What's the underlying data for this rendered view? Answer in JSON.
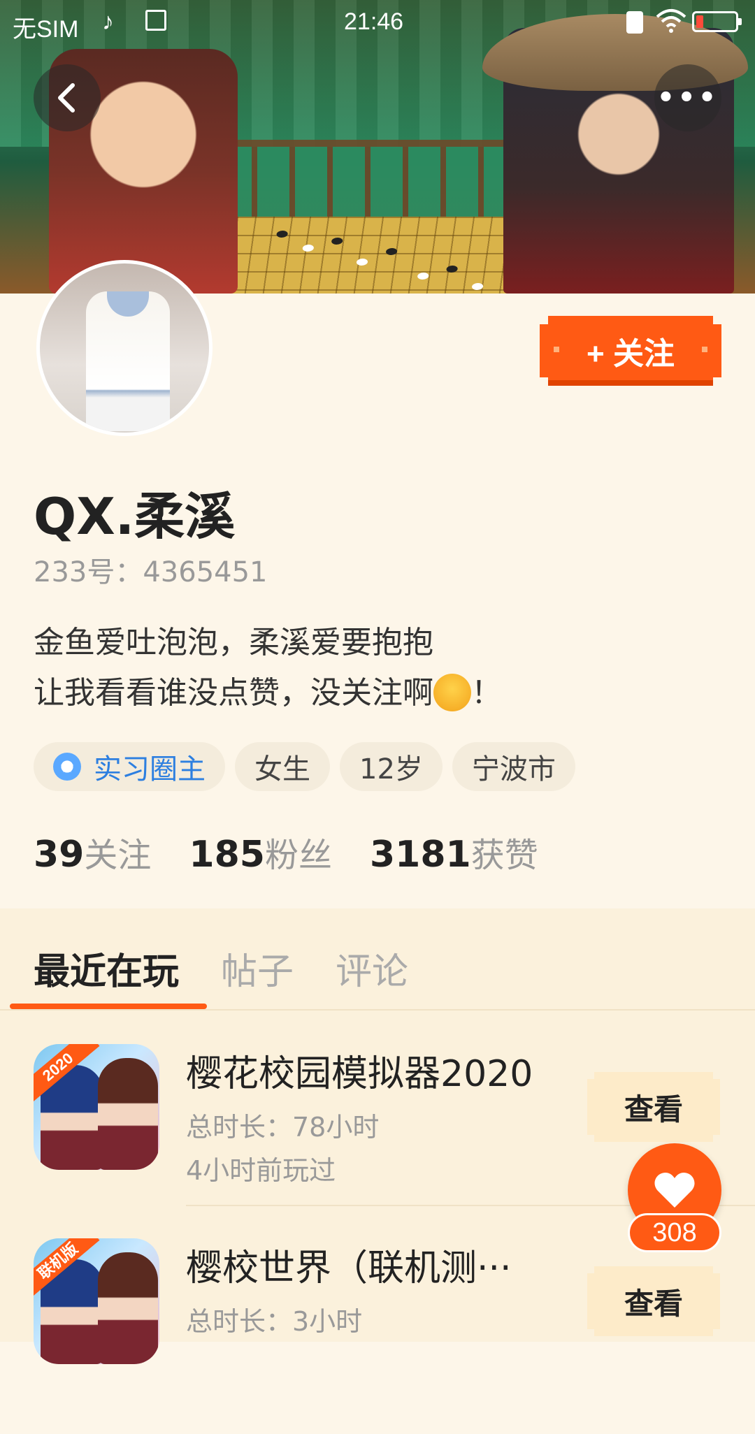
{
  "status_bar": {
    "carrier": "无SIM",
    "time": "21:46",
    "icons": [
      "tiktok-icon",
      "sim-icon",
      "charging-icon",
      "wifi-icon",
      "battery-low-icon"
    ]
  },
  "header": {
    "back_icon": "chevron-left-icon",
    "more_icon": "ellipsis-icon",
    "more_label": "•••"
  },
  "profile": {
    "follow_label": "+ 关注",
    "nickname": "QX.柔溪",
    "uid": "233号：4365451",
    "bio_line1": "金鱼爱吐泡泡，柔溪爱要抱抱",
    "bio_line2_before": "让我看看谁没点赞，没关注啊",
    "bio_line2_after": "！",
    "tags": {
      "badge": "实习圈主",
      "gender": "女生",
      "age": "12岁",
      "city": "宁波市"
    },
    "stats": {
      "following_num": "39",
      "following_label": "关注",
      "fans_num": "185",
      "fans_label": "粉丝",
      "likes_num": "3181",
      "likes_label": "获赞"
    }
  },
  "tabs": {
    "recent": "最近在玩",
    "posts": "帖子",
    "comments": "评论",
    "active": "最近在玩"
  },
  "games": [
    {
      "title": "樱花校园模拟器2020",
      "ribbon": "2020",
      "duration": "总时长：78小时",
      "last_played": "4小时前玩过",
      "button": "查看"
    },
    {
      "title": "樱校世界（联机测···",
      "ribbon": "联机版",
      "duration": "总时长：3小时",
      "button": "查看"
    }
  ],
  "like_fab": {
    "count": "308"
  },
  "colors": {
    "accent": "#ff5a14",
    "background": "#fdf6e9",
    "badge_blue": "#2d7fe0"
  }
}
